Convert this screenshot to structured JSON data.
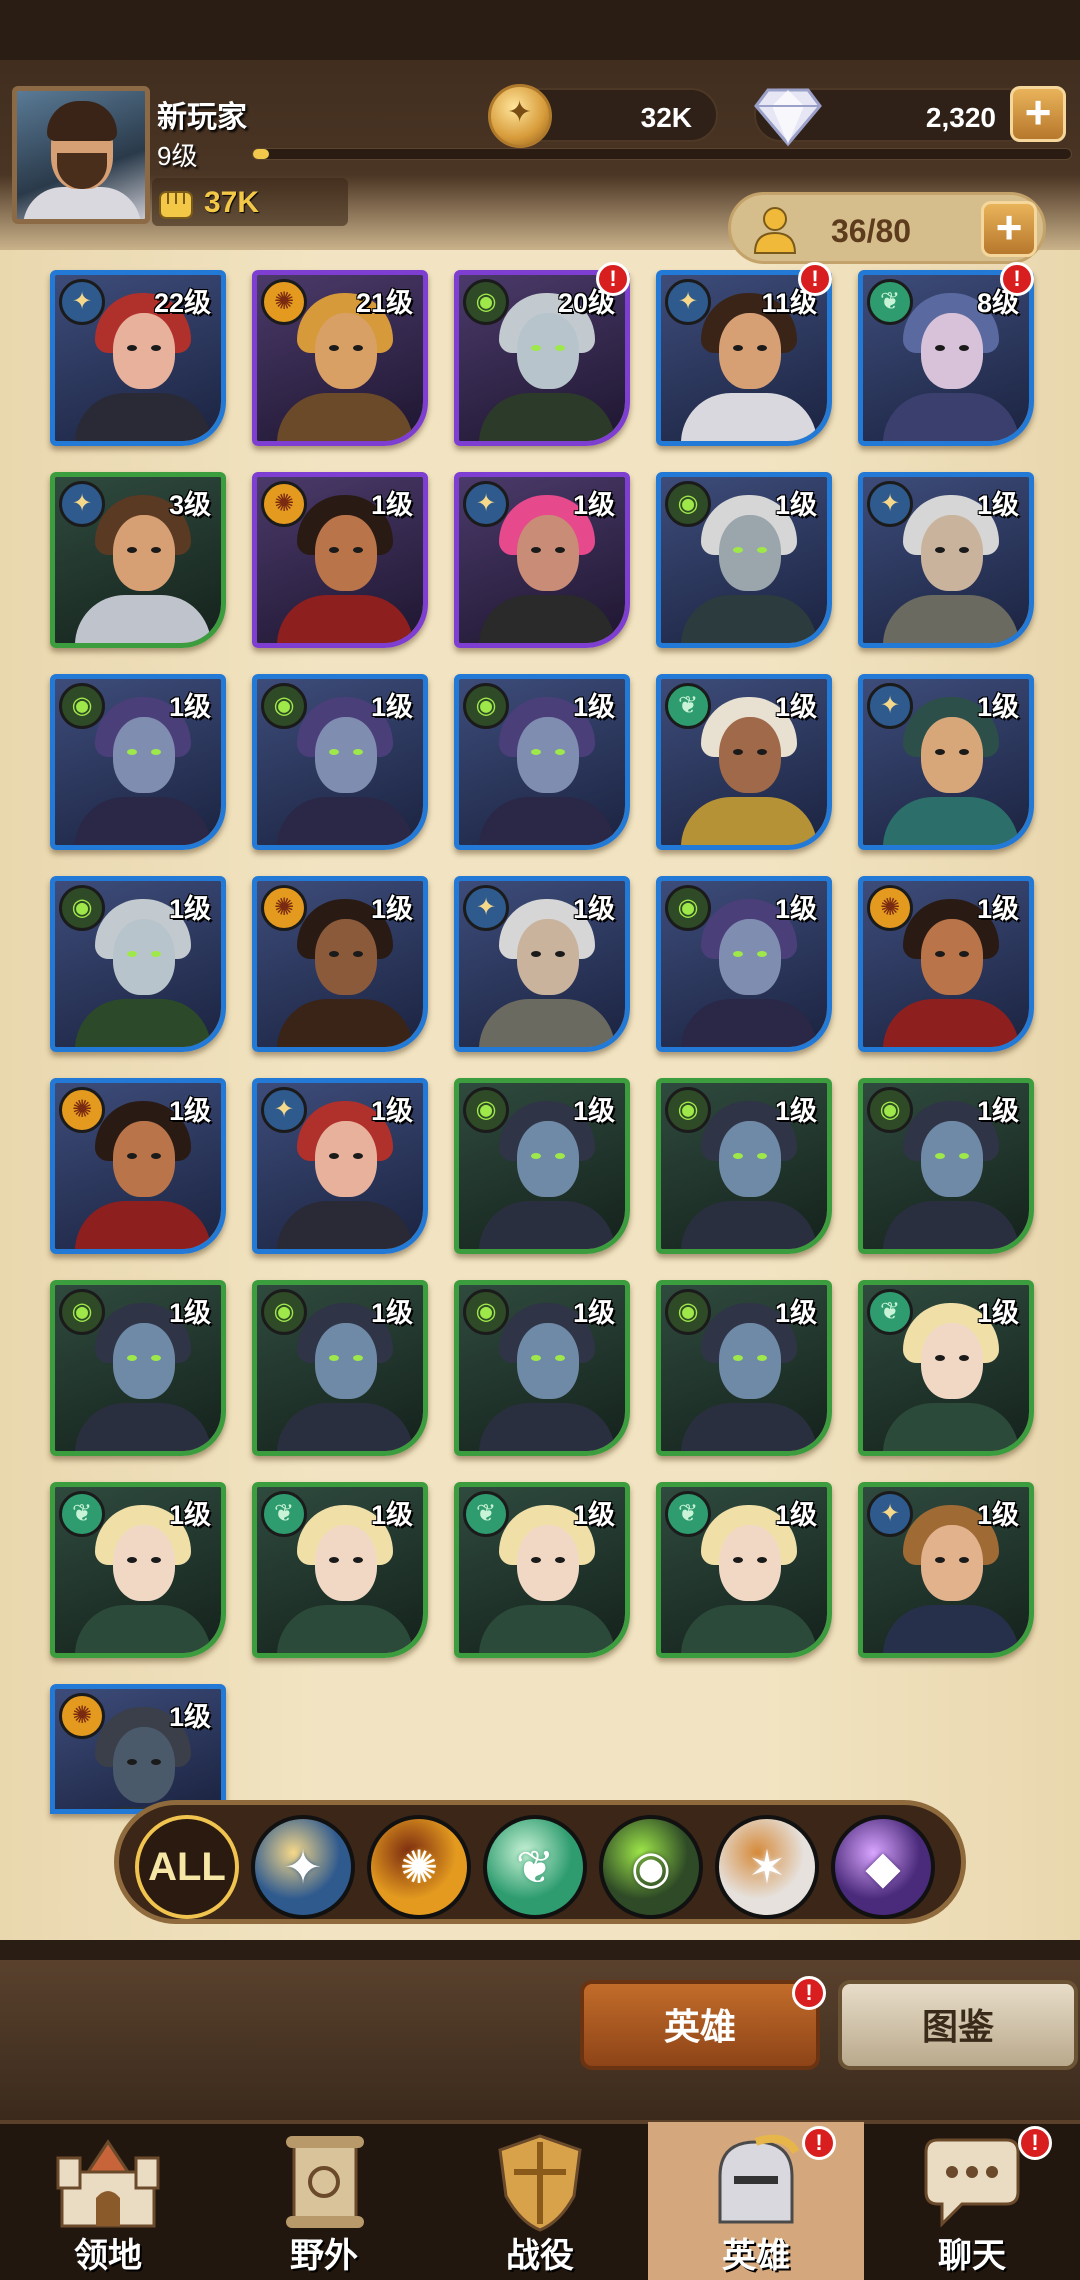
{
  "player": {
    "name": "新玩家",
    "level": "9级",
    "xp_fraction": 0.02,
    "power": "37K"
  },
  "currency": {
    "gold": "32K",
    "gems": "2,320"
  },
  "roster": {
    "capacity": "36/80"
  },
  "colors": {
    "blue_frame": "#2379d6",
    "purple_frame": "#7d3ed1",
    "green_frame": "#3b9d3e",
    "alert_red": "#d81e1e",
    "gold_text": "#f3c847"
  },
  "heroes": [
    {
      "level": "22级",
      "faction": "star",
      "rarity": "blue",
      "alert": false,
      "skin": "#e7b19c",
      "hair": "#b0312b",
      "cloth": "#2a2a36"
    },
    {
      "level": "21级",
      "faction": "sun",
      "rarity": "purple",
      "alert": false,
      "skin": "#d9a066",
      "hair": "#d69a3a",
      "cloth": "#6b4a2a"
    },
    {
      "level": "20级",
      "faction": "eye",
      "rarity": "purple",
      "alert": true,
      "skin": "#b8c4cc",
      "hair": "#c2c9cf",
      "cloth": "#2c3a2a"
    },
    {
      "level": "11级",
      "faction": "star",
      "rarity": "blue",
      "alert": true,
      "skin": "#d79f74",
      "hair": "#3a2418",
      "cloth": "#d8d8de"
    },
    {
      "level": "8级",
      "faction": "leaf",
      "rarity": "blue",
      "alert": true,
      "skin": "#d7c2d9",
      "hair": "#5a6aa0",
      "cloth": "#3b3f6e"
    },
    {
      "level": "3级",
      "faction": "star",
      "rarity": "green",
      "alert": false,
      "skin": "#d79f74",
      "hair": "#5a3a22",
      "cloth": "#bfc4cc"
    },
    {
      "level": "1级",
      "faction": "sun",
      "rarity": "purple",
      "alert": false,
      "skin": "#b9744a",
      "hair": "#2a1a14",
      "cloth": "#8e1f1f"
    },
    {
      "level": "1级",
      "faction": "star",
      "rarity": "purple",
      "alert": false,
      "skin": "#c98c76",
      "hair": "#e64a8c",
      "cloth": "#2a2a2a"
    },
    {
      "level": "1级",
      "faction": "eye",
      "rarity": "blue",
      "alert": false,
      "skin": "#9aa6ac",
      "hair": "#d6d6d6",
      "cloth": "#2b3b3e"
    },
    {
      "level": "1级",
      "faction": "star",
      "rarity": "blue",
      "alert": false,
      "skin": "#c9b39c",
      "hair": "#d6d6d6",
      "cloth": "#6a6a60"
    },
    {
      "level": "1级",
      "faction": "eye",
      "rarity": "blue",
      "alert": false,
      "skin": "#7f8db0",
      "hair": "#4b3f7a",
      "cloth": "#2b2747"
    },
    {
      "level": "1级",
      "faction": "eye",
      "rarity": "blue",
      "alert": false,
      "skin": "#7f8db0",
      "hair": "#4b3f7a",
      "cloth": "#2b2747"
    },
    {
      "level": "1级",
      "faction": "eye",
      "rarity": "blue",
      "alert": false,
      "skin": "#7f8db0",
      "hair": "#4b3f7a",
      "cloth": "#2b2747"
    },
    {
      "level": "1级",
      "faction": "leaf",
      "rarity": "blue",
      "alert": false,
      "skin": "#a06a4a",
      "hair": "#e8e0d0",
      "cloth": "#b59236"
    },
    {
      "level": "1级",
      "faction": "star",
      "rarity": "blue",
      "alert": false,
      "skin": "#d7a77a",
      "hair": "#2d4f4a",
      "cloth": "#2b6e6a"
    },
    {
      "level": "1级",
      "faction": "eye",
      "rarity": "blue",
      "alert": false,
      "skin": "#b8c4cc",
      "hair": "#c2c9cf",
      "cloth": "#2c4a2a"
    },
    {
      "level": "1级",
      "faction": "sun",
      "rarity": "blue",
      "alert": false,
      "skin": "#8a5a3a",
      "hair": "#2a1a14",
      "cloth": "#3a2418"
    },
    {
      "level": "1级",
      "faction": "star",
      "rarity": "blue",
      "alert": false,
      "skin": "#c9b39c",
      "hair": "#d6d6d6",
      "cloth": "#6a6a60"
    },
    {
      "level": "1级",
      "faction": "eye",
      "rarity": "blue",
      "alert": false,
      "skin": "#7f8db0",
      "hair": "#4b3f7a",
      "cloth": "#2b2747"
    },
    {
      "level": "1级",
      "faction": "sun",
      "rarity": "blue",
      "alert": false,
      "skin": "#b9744a",
      "hair": "#2a1a14",
      "cloth": "#8e1f1f"
    },
    {
      "level": "1级",
      "faction": "sun",
      "rarity": "blue",
      "alert": false,
      "skin": "#b9744a",
      "hair": "#2a1a14",
      "cloth": "#8e1f1f"
    },
    {
      "level": "1级",
      "faction": "star",
      "rarity": "blue",
      "alert": false,
      "skin": "#e7b19c",
      "hair": "#b0312b",
      "cloth": "#2a2a36"
    },
    {
      "level": "1级",
      "faction": "eye",
      "rarity": "green",
      "alert": false,
      "skin": "#6f8aa6",
      "hair": "#2f3447",
      "cloth": "#2a2f3f"
    },
    {
      "level": "1级",
      "faction": "eye",
      "rarity": "green",
      "alert": false,
      "skin": "#6f8aa6",
      "hair": "#2f3447",
      "cloth": "#2a2f3f"
    },
    {
      "level": "1级",
      "faction": "eye",
      "rarity": "green",
      "alert": false,
      "skin": "#6f8aa6",
      "hair": "#2f3447",
      "cloth": "#2a2f3f"
    },
    {
      "level": "1级",
      "faction": "eye",
      "rarity": "green",
      "alert": false,
      "skin": "#6f8aa6",
      "hair": "#2f3447",
      "cloth": "#2a2f3f"
    },
    {
      "level": "1级",
      "faction": "eye",
      "rarity": "green",
      "alert": false,
      "skin": "#6f8aa6",
      "hair": "#2f3447",
      "cloth": "#2a2f3f"
    },
    {
      "level": "1级",
      "faction": "eye",
      "rarity": "green",
      "alert": false,
      "skin": "#6f8aa6",
      "hair": "#2f3447",
      "cloth": "#2a2f3f"
    },
    {
      "level": "1级",
      "faction": "eye",
      "rarity": "green",
      "alert": false,
      "skin": "#6f8aa6",
      "hair": "#2f3447",
      "cloth": "#2a2f3f"
    },
    {
      "level": "1级",
      "faction": "leaf",
      "rarity": "green",
      "alert": false,
      "skin": "#f0d8c4",
      "hair": "#f0e0a8",
      "cloth": "#2b4a3a"
    },
    {
      "level": "1级",
      "faction": "leaf",
      "rarity": "green",
      "alert": false,
      "skin": "#f0d8c4",
      "hair": "#f0e0a8",
      "cloth": "#2b4a3a"
    },
    {
      "level": "1级",
      "faction": "leaf",
      "rarity": "green",
      "alert": false,
      "skin": "#f0d8c4",
      "hair": "#f0e0a8",
      "cloth": "#2b4a3a"
    },
    {
      "level": "1级",
      "faction": "leaf",
      "rarity": "green",
      "alert": false,
      "skin": "#f0d8c4",
      "hair": "#f0e0a8",
      "cloth": "#2b4a3a"
    },
    {
      "level": "1级",
      "faction": "leaf",
      "rarity": "green",
      "alert": false,
      "skin": "#f0d8c4",
      "hair": "#f0e0a8",
      "cloth": "#2b4a3a"
    },
    {
      "level": "1级",
      "faction": "star",
      "rarity": "green",
      "alert": false,
      "skin": "#e2b28c",
      "hair": "#a06a34",
      "cloth": "#27304a"
    },
    {
      "level": "1级",
      "faction": "sun",
      "rarity": "blue",
      "alert": false,
      "skin": "#4b5a6a",
      "hair": "#3a3f4a",
      "cloth": "#2a3038"
    }
  ],
  "filters": [
    {
      "id": "all",
      "label": "ALL",
      "icon": "all-filter",
      "selected": true
    },
    {
      "id": "star",
      "icon": "star-faction-icon",
      "bg": "#2f5a8e",
      "fg": "#f5d88a",
      "glyph": "✦"
    },
    {
      "id": "sun",
      "icon": "sun-faction-icon",
      "bg": "#e39a1f",
      "fg": "#7a2a10",
      "glyph": "✺"
    },
    {
      "id": "leaf",
      "icon": "leaf-faction-icon",
      "bg": "#2e9c6f",
      "fg": "#c9f3d7",
      "glyph": "❦"
    },
    {
      "id": "eye",
      "icon": "eye-faction-icon",
      "bg": "#2e4a26",
      "fg": "#9fe84a",
      "glyph": "◉"
    },
    {
      "id": "light",
      "icon": "light-faction-icon",
      "bg": "#e6e1dc",
      "fg": "#d58a3a",
      "glyph": "✶"
    },
    {
      "id": "void",
      "icon": "void-faction-icon",
      "bg": "#4a2a7a",
      "fg": "#d9a5ff",
      "glyph": "◆"
    }
  ],
  "subtabs": {
    "heroes": "英雄",
    "codex": "图鉴"
  },
  "nav": [
    {
      "label": "领地",
      "icon": "castle-icon",
      "alert": false
    },
    {
      "label": "野外",
      "icon": "scroll-map-icon",
      "alert": false
    },
    {
      "label": "战役",
      "icon": "battle-shield-icon",
      "alert": false
    },
    {
      "label": "英雄",
      "icon": "knight-helmet-icon",
      "alert": true,
      "active": true
    },
    {
      "label": "聊天",
      "icon": "chat-bubble-icon",
      "alert": true
    }
  ]
}
